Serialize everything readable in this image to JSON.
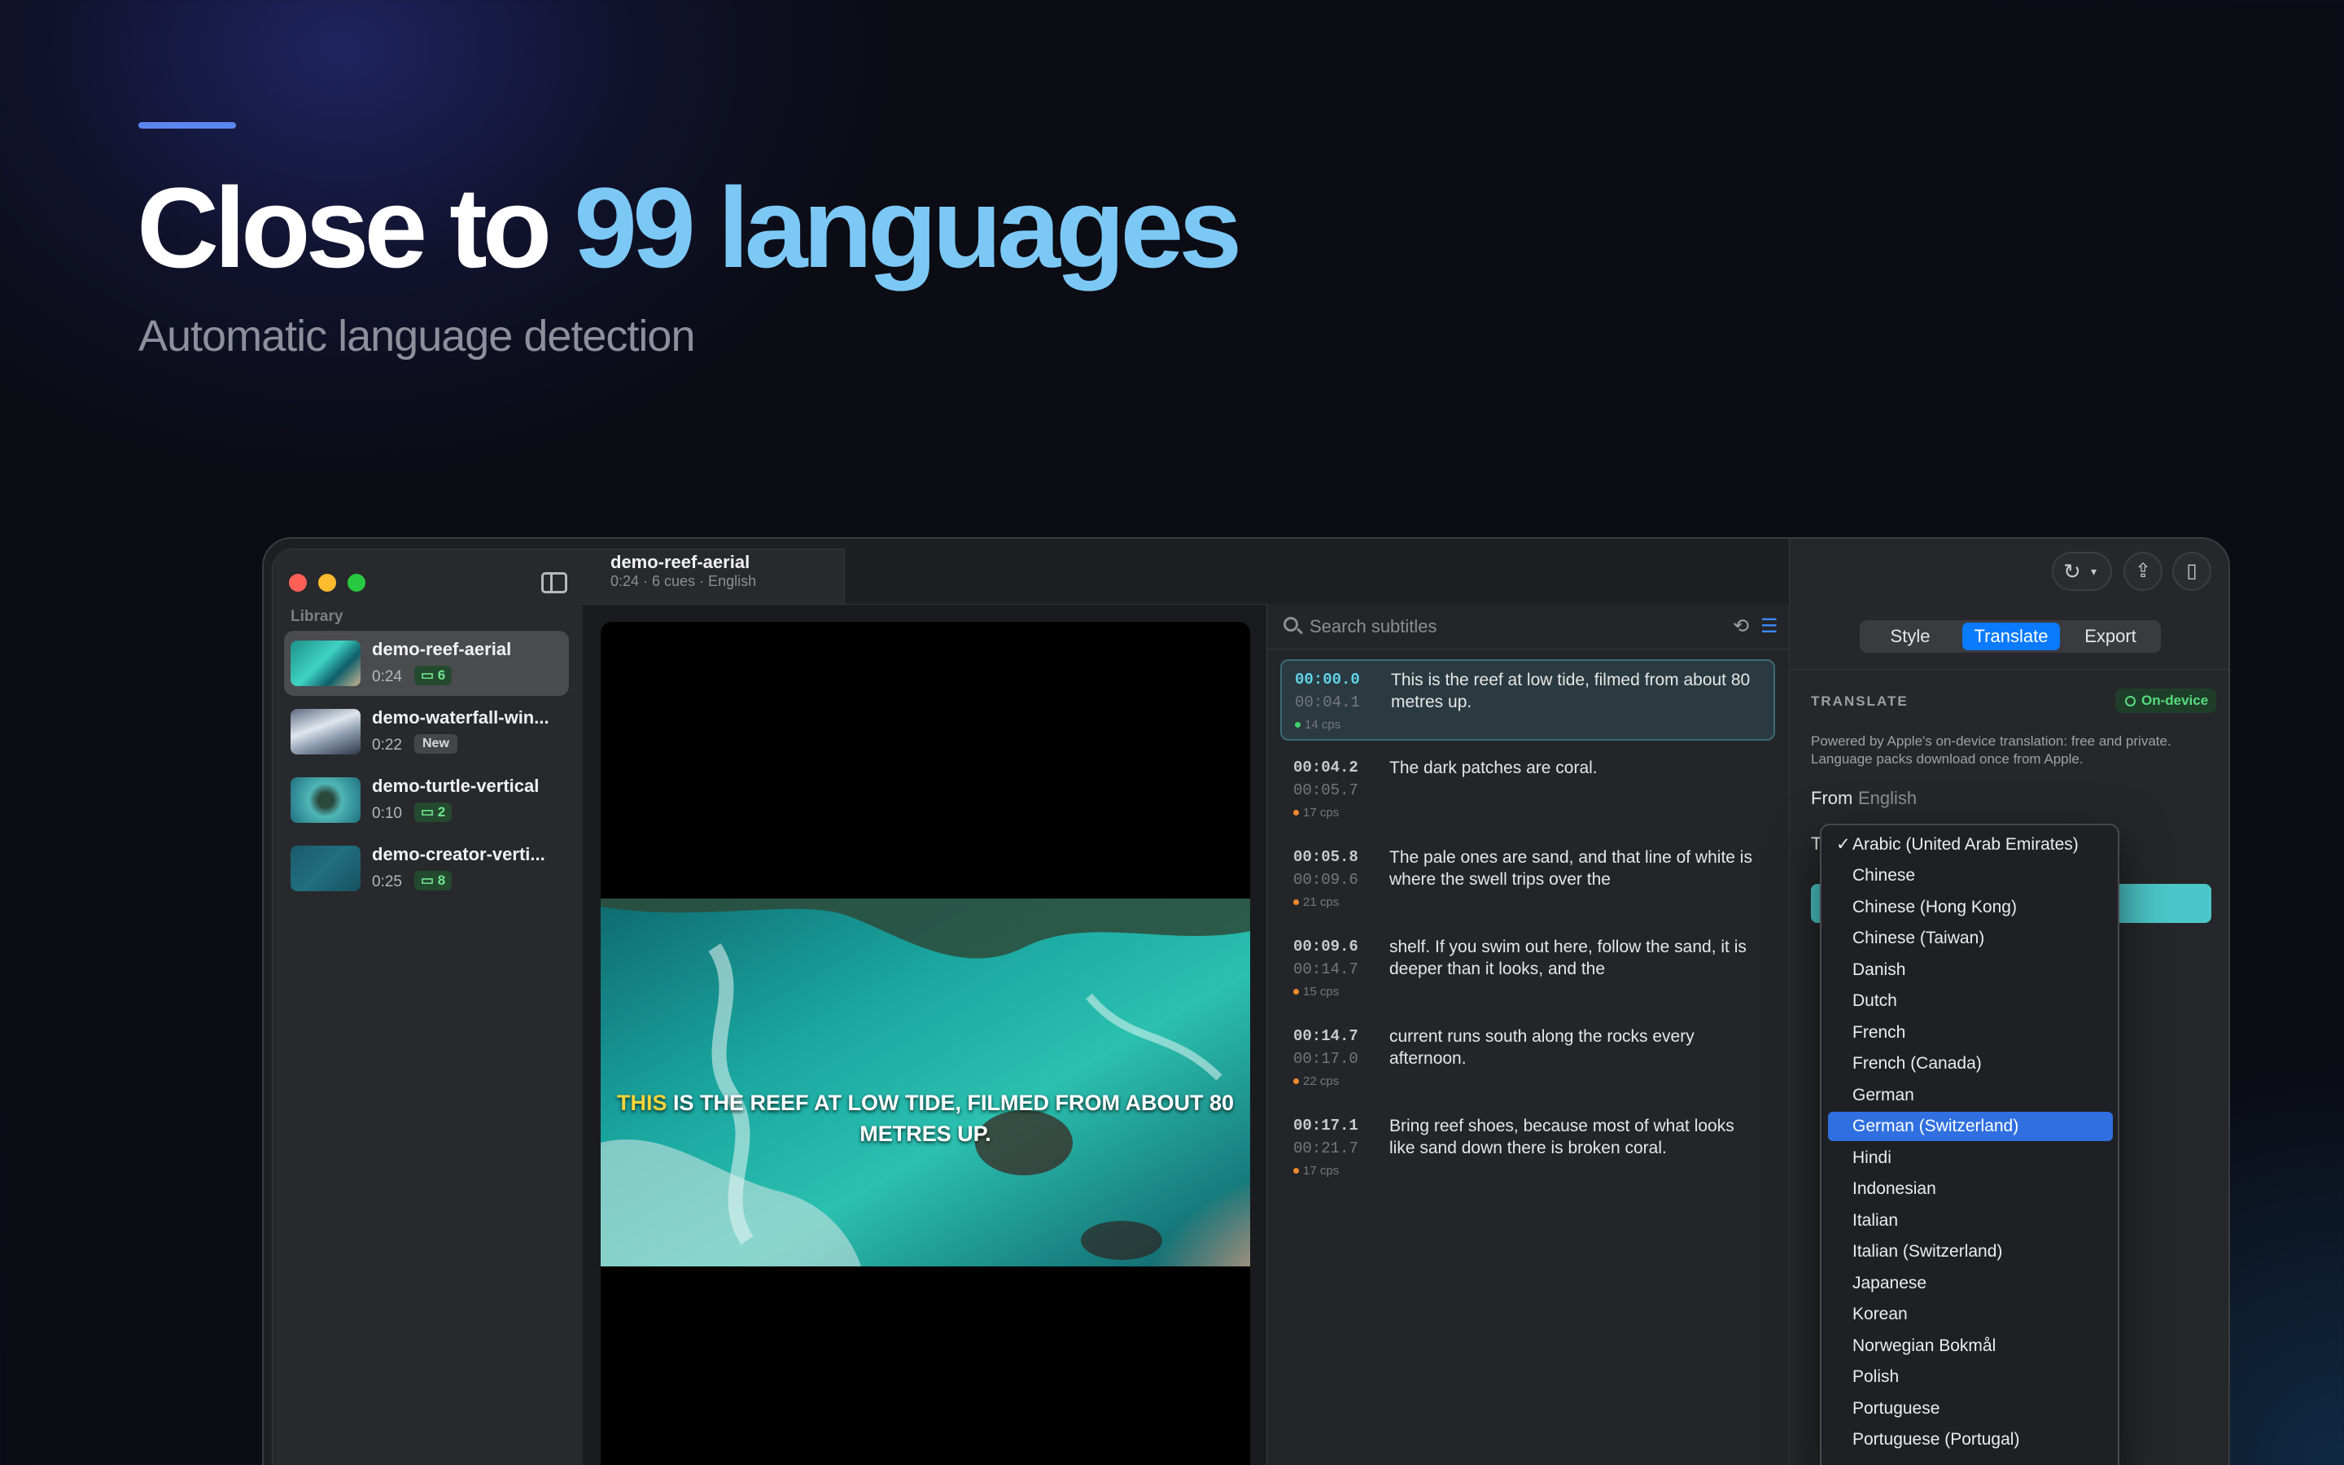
{
  "hero": {
    "headline_prefix": "Close to ",
    "headline_highlight": "99 languages",
    "subhead": "Automatic language detection"
  },
  "colors": {
    "accent": "#0a7aff",
    "highlight_text": "#7cc8f5",
    "caption_highlight": "#f5d43a",
    "ondevice_green": "#57dc7e"
  },
  "sidebar": {
    "section_label": "Library",
    "items": [
      {
        "name": "demo-reef-aerial",
        "duration": "0:24",
        "badge": "6",
        "badge_type": "count"
      },
      {
        "name": "demo-waterfall-win...",
        "duration": "0:22",
        "badge": "New",
        "badge_type": "new"
      },
      {
        "name": "demo-turtle-vertical",
        "duration": "0:10",
        "badge": "2",
        "badge_type": "count"
      },
      {
        "name": "demo-creator-verti...",
        "duration": "0:25",
        "badge": "8",
        "badge_type": "count"
      }
    ]
  },
  "header": {
    "title": "demo-reef-aerial",
    "meta": "0:24 · 6 cues · English"
  },
  "video": {
    "caption_highlight": "THIS",
    "caption_rest": " IS THE REEF AT LOW TIDE, FILMED FROM ABOUT 80 METRES UP."
  },
  "cues_panel": {
    "search_placeholder": "Search subtitles",
    "loop_icon": "loop-icon",
    "list_icon": "list-icon",
    "cues": [
      {
        "start": "00:00.0",
        "end": "00:04.1",
        "cps": "14 cps",
        "cps_color": "#3fcf6a",
        "text": "This is the reef at low tide, filmed from about 80 metres up."
      },
      {
        "start": "00:04.2",
        "end": "00:05.7",
        "cps": "17 cps",
        "cps_color": "#f08a2e",
        "text": "The dark patches are coral."
      },
      {
        "start": "00:05.8",
        "end": "00:09.6",
        "cps": "21 cps",
        "cps_color": "#f08a2e",
        "text": "The pale ones are sand, and that line of white is where the swell trips over the"
      },
      {
        "start": "00:09.6",
        "end": "00:14.7",
        "cps": "15 cps",
        "cps_color": "#f08a2e",
        "text": "shelf. If you swim out here, follow the sand, it is deeper than it looks, and the"
      },
      {
        "start": "00:14.7",
        "end": "00:17.0",
        "cps": "22 cps",
        "cps_color": "#f08a2e",
        "text": "current runs south along the rocks every afternoon."
      },
      {
        "start": "00:17.1",
        "end": "00:21.7",
        "cps": "17 cps",
        "cps_color": "#f08a2e",
        "text": "Bring reef shoes, because most of what looks like sand down there is broken coral."
      }
    ]
  },
  "inspector": {
    "tabs": [
      "Style",
      "Translate",
      "Export"
    ],
    "active_tab": "Translate",
    "section_title": "TRANSLATE",
    "on_device_label": "On-device",
    "powered_text": "Powered by Apple's on-device translation: free and private. Language packs download once from Apple.",
    "from_label": "From",
    "from_value": "English",
    "to_label": "To"
  },
  "language_menu": {
    "selected": "Arabic (United Arab Emirates)",
    "highlighted": "German (Switzerland)",
    "options": [
      "Arabic (United Arab Emirates)",
      "Chinese",
      "Chinese (Hong Kong)",
      "Chinese (Taiwan)",
      "Danish",
      "Dutch",
      "French",
      "French (Canada)",
      "German",
      "German (Switzerland)",
      "Hindi",
      "Indonesian",
      "Italian",
      "Italian (Switzerland)",
      "Japanese",
      "Korean",
      "Norwegian Bokmål",
      "Polish",
      "Portuguese",
      "Portuguese (Portugal)"
    ]
  }
}
